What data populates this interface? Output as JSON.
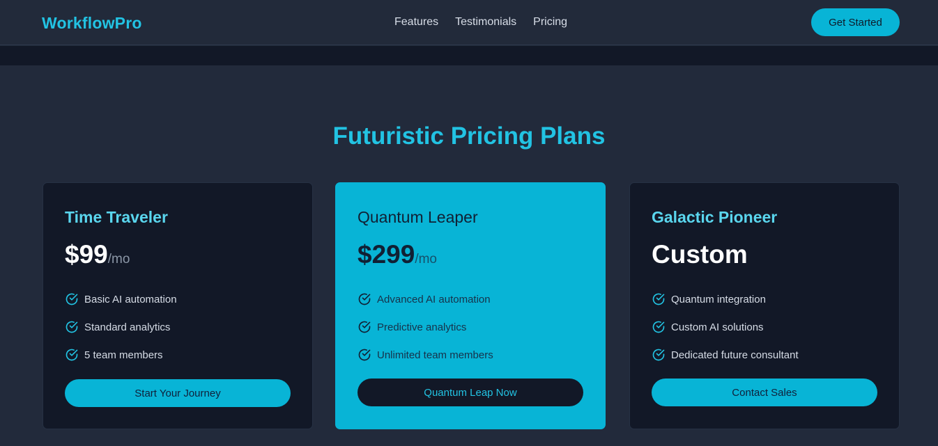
{
  "header": {
    "brand": "WorkflowPro",
    "nav": [
      "Features",
      "Testimonials",
      "Pricing"
    ],
    "cta_label": "Get Started"
  },
  "pricing": {
    "title": "Futuristic Pricing Plans",
    "plans": [
      {
        "name": "Time Traveler",
        "price": "$99",
        "period": "/mo",
        "features": [
          "Basic AI automation",
          "Standard analytics",
          "5 team members"
        ],
        "button": "Start Your Journey",
        "highlighted": false
      },
      {
        "name": "Quantum Leaper",
        "price": "$299",
        "period": "/mo",
        "features": [
          "Advanced AI automation",
          "Predictive analytics",
          "Unlimited team members"
        ],
        "button": "Quantum Leap Now",
        "highlighted": true
      },
      {
        "name": "Galactic Pioneer",
        "price": "Custom",
        "period": "",
        "features": [
          "Quantum integration",
          "Custom AI solutions",
          "Dedicated future consultant"
        ],
        "button": "Contact Sales",
        "highlighted": false
      }
    ]
  },
  "colors": {
    "accent": "#08b4d6",
    "brand": "#22c3e3",
    "background": "#222a3b",
    "card": "#121827"
  },
  "icons": {
    "feature": "check-circle-icon"
  }
}
